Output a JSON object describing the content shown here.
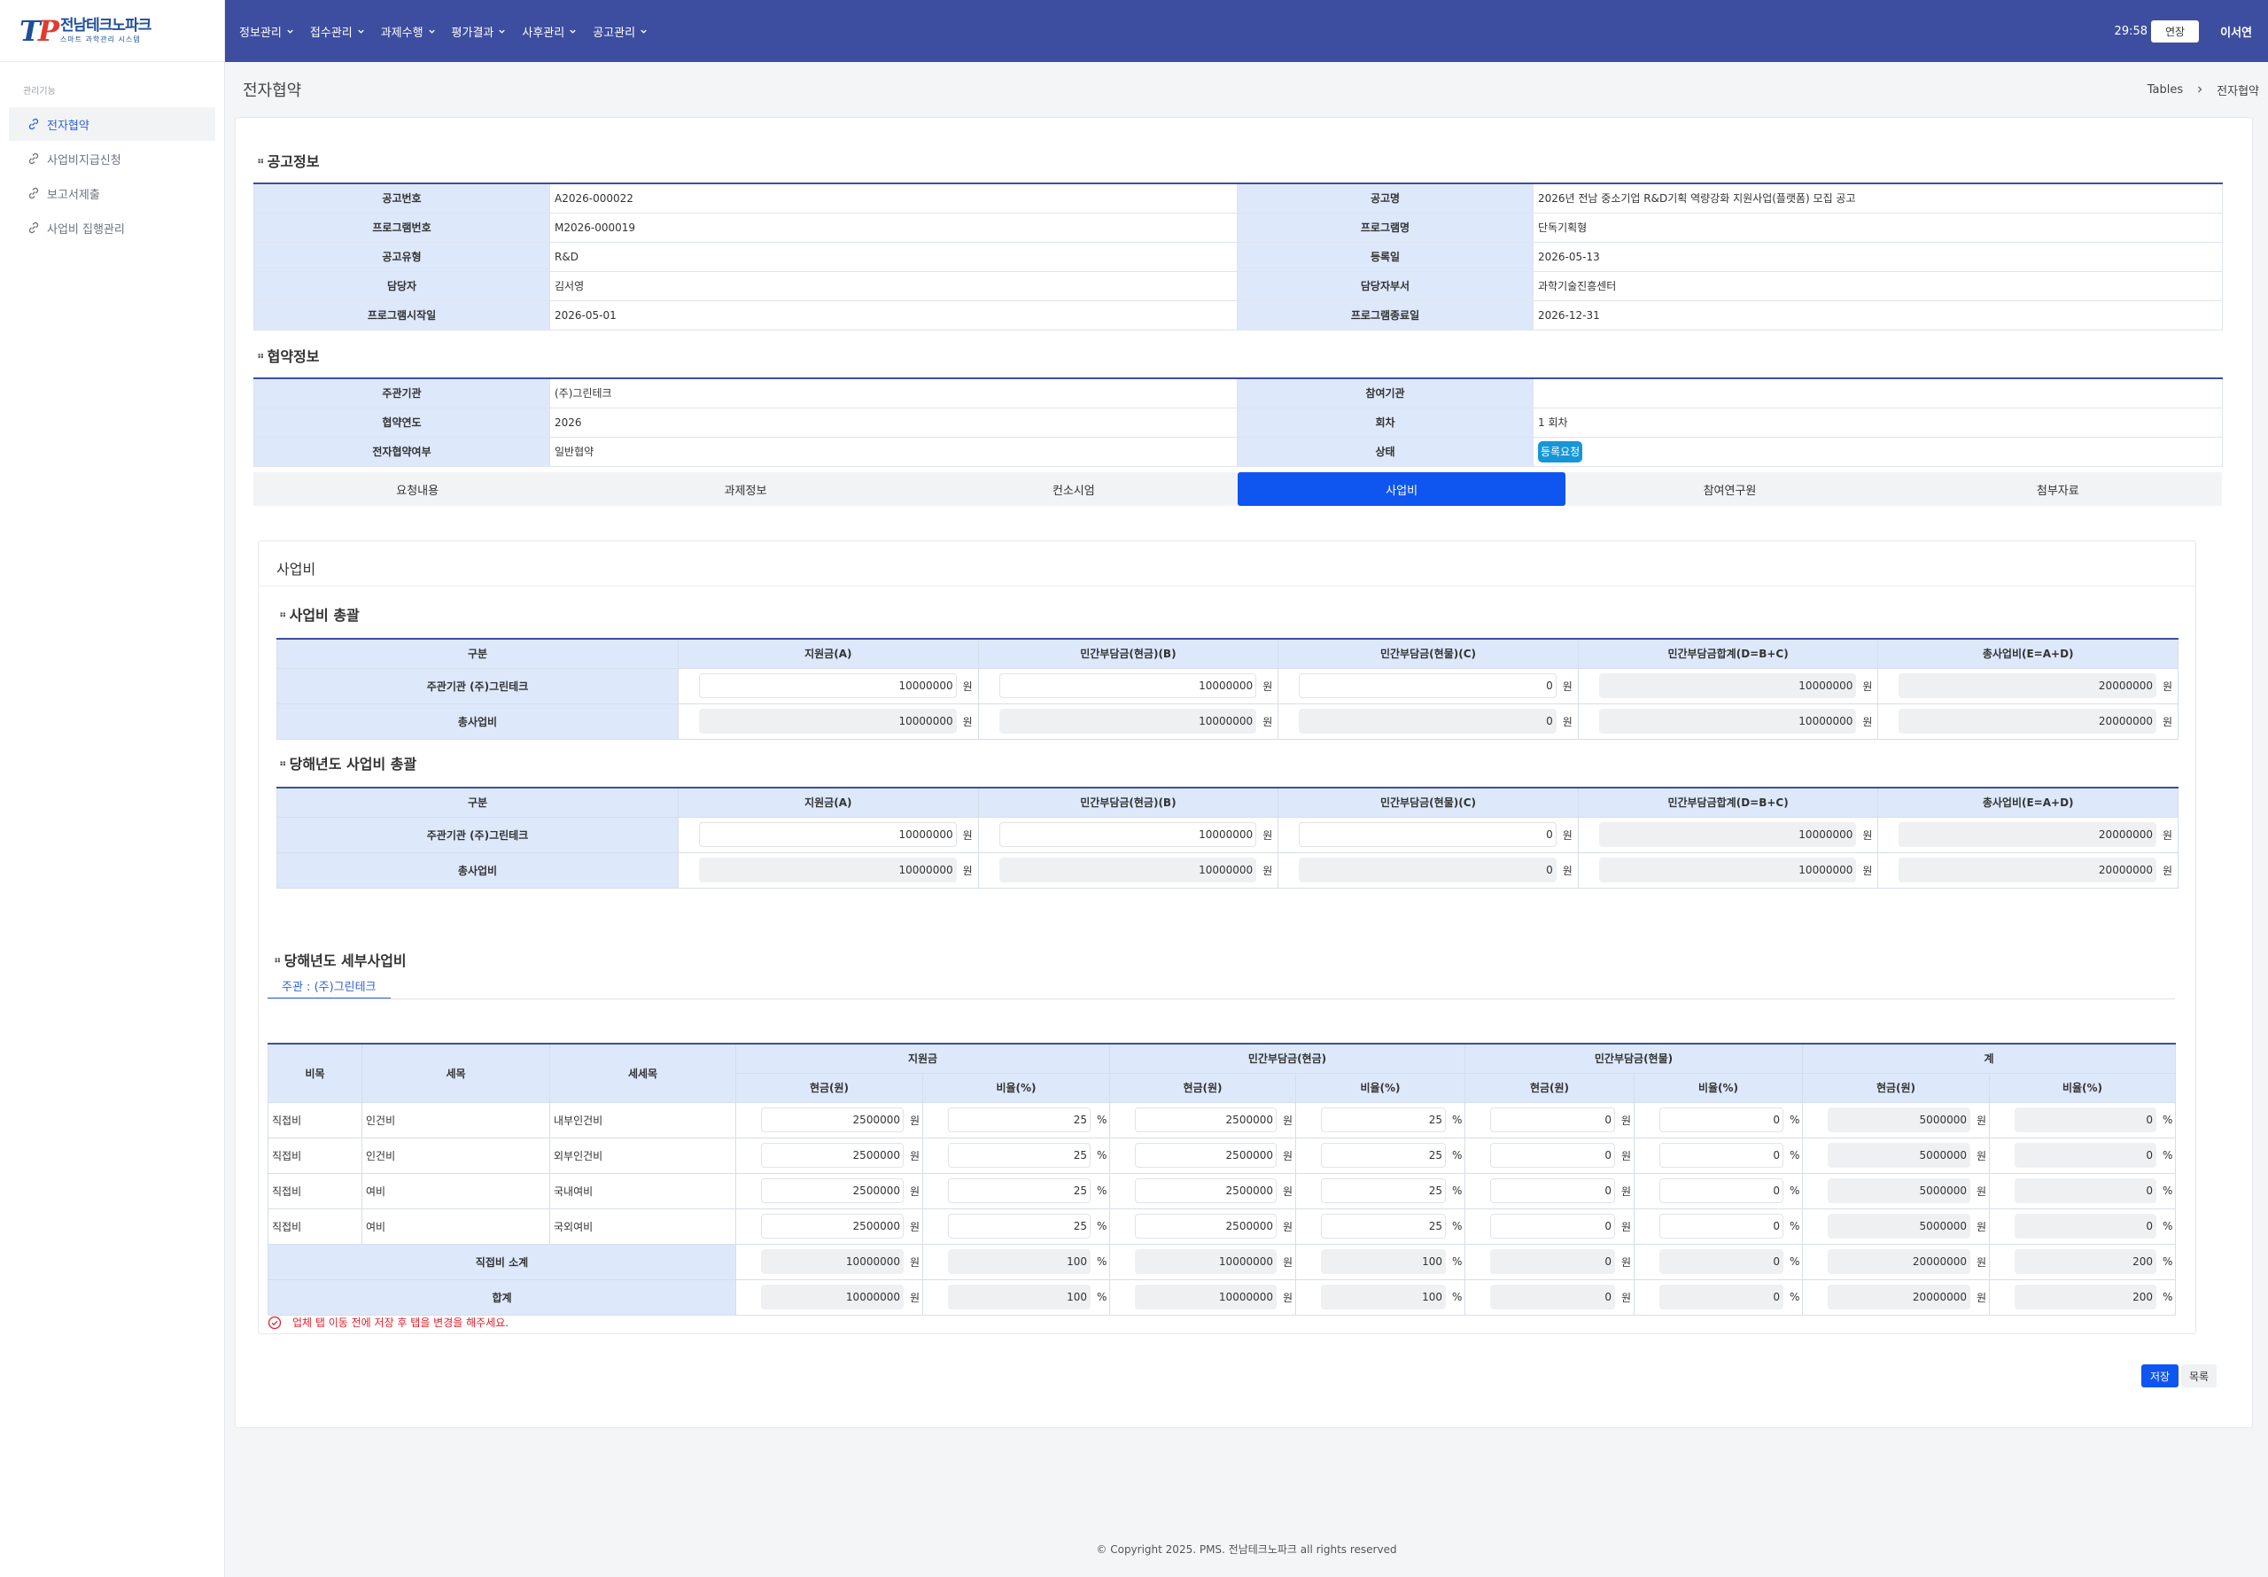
{
  "logo": {
    "mark": "TP",
    "name": "전남테크노파크",
    "sub": "스마트 과학관리 시스템"
  },
  "sidebar": {
    "section_title": "관리기능",
    "items": [
      {
        "label": "전자협약",
        "active": true
      },
      {
        "label": "사업비지급신청"
      },
      {
        "label": "보고서제출"
      },
      {
        "label": "사업비 집행관리"
      }
    ]
  },
  "topnav": {
    "items": [
      "정보관리",
      "접수관리",
      "과제수행",
      "평가결과",
      "사후관리",
      "공고관리"
    ],
    "timer": "29:58",
    "extend_label": "연장",
    "user": "이서연"
  },
  "page": {
    "title": "전자협약",
    "breadcrumb": [
      "Tables",
      "전자협약"
    ]
  },
  "notice": {
    "title": "공고정보",
    "rows": [
      [
        "공고번호",
        "A2026-000022",
        "공고명",
        "2026년 전남 중소기업 R&D기획 역량강화 지원사업(플랫폼) 모집 공고"
      ],
      [
        "프로그램번호",
        "M2026-000019",
        "프로그램명",
        "단독기획형"
      ],
      [
        "공고유형",
        "R&D",
        "등록일",
        "2026-05-13"
      ],
      [
        "담당자",
        "김서영",
        "담당자부서",
        "과학기술진흥센터"
      ],
      [
        "프로그램시작일",
        "2026-05-01",
        "프로그램종료일",
        "2026-12-31"
      ]
    ]
  },
  "agreement": {
    "title": "협약정보",
    "rows": [
      [
        "주관기관",
        "(주)그린테크",
        "참여기관",
        ""
      ],
      [
        "협약연도",
        "2026",
        "회차",
        "1 회차"
      ],
      [
        "전자협약여부",
        "일반협약",
        "상태",
        ""
      ]
    ],
    "status": "등록요청"
  },
  "tabs": [
    "요청내용",
    "과제정보",
    "컨소시엄",
    "사업비",
    "참여연구원",
    "첨부자료"
  ],
  "active_tab": "사업비",
  "budget": {
    "title": "사업비",
    "unit": "원",
    "pct": "%",
    "summary_headers": [
      "구분",
      "지원금(A)",
      "민간부담금(현금)(B)",
      "민간부담금(현물)(C)",
      "민간부담금합계(D=B+C)",
      "총사업비(E=A+D)"
    ],
    "total": {
      "title": "사업비 총괄",
      "rows": [
        {
          "label": "주관기관  (주)그린테크",
          "values": [
            "10000000",
            "10000000",
            "0",
            "10000000",
            "20000000"
          ]
        },
        {
          "label": "총사업비",
          "values": [
            "10000000",
            "10000000",
            "0",
            "10000000",
            "20000000"
          ]
        }
      ]
    },
    "year": {
      "title": "당해년도 사업비 총괄",
      "rows": [
        {
          "label": "주관기관  (주)그린테크",
          "values": [
            "10000000",
            "10000000",
            "0",
            "10000000",
            "20000000"
          ]
        },
        {
          "label": "총사업비",
          "values": [
            "10000000",
            "10000000",
            "0",
            "10000000",
            "20000000"
          ]
        }
      ]
    },
    "org_tab": "주관 : (주)그린테크",
    "detail": {
      "title": "당해년도 세부사업비",
      "headers": {
        "c1": "비목",
        "c2": "세목",
        "c3": "세세목",
        "g1": "지원금",
        "g2": "민간부담금(현금)",
        "g3": "민간부담금(현물)",
        "g4": "계",
        "cash": "현금(원)",
        "ratio": "비율(%)"
      },
      "rows": [
        {
          "c1": "직접비",
          "c2": "인건비",
          "c3": "내부인건비",
          "v": [
            "2500000",
            "25",
            "2500000",
            "25",
            "0",
            "0",
            "5000000",
            "0"
          ]
        },
        {
          "c1": "직접비",
          "c2": "인건비",
          "c3": "외부인건비",
          "v": [
            "2500000",
            "25",
            "2500000",
            "25",
            "0",
            "0",
            "5000000",
            "0"
          ]
        },
        {
          "c1": "직접비",
          "c2": "여비",
          "c3": "국내여비",
          "v": [
            "2500000",
            "25",
            "2500000",
            "25",
            "0",
            "0",
            "5000000",
            "0"
          ]
        },
        {
          "c1": "직접비",
          "c2": "여비",
          "c3": "국외여비",
          "v": [
            "2500000",
            "25",
            "2500000",
            "25",
            "0",
            "0",
            "5000000",
            "0"
          ]
        }
      ],
      "subtotal": {
        "label": "직접비 소계",
        "v": [
          "10000000",
          "100",
          "10000000",
          "100",
          "0",
          "0",
          "20000000",
          "200"
        ]
      },
      "total": {
        "label": "합계",
        "v": [
          "10000000",
          "100",
          "10000000",
          "100",
          "0",
          "0",
          "20000000",
          "200"
        ]
      }
    },
    "warning": "업체 탭 이동 전에 저장 후 탭을 변경을 해주세요."
  },
  "buttons": {
    "save": "저장",
    "list": "목록"
  },
  "footer": "© Copyright 2025. PMS. 전남테크노파크 all rights reserved"
}
